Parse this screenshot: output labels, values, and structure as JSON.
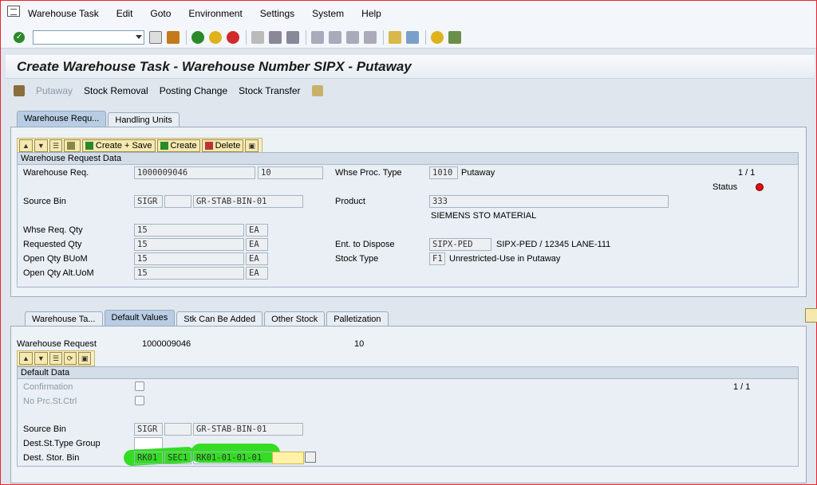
{
  "menu": [
    "Warehouse Task",
    "Edit",
    "Goto",
    "Environment",
    "Settings",
    "System",
    "Help"
  ],
  "title": "Create Warehouse Task - Warehouse Number SIPX - Putaway",
  "app_toolbar": {
    "putaway": "Putaway",
    "stock_removal": "Stock Removal",
    "posting_change": "Posting Change",
    "stock_transfer": "Stock Transfer"
  },
  "top_tabs": [
    "Warehouse Requ...",
    "Handling Units"
  ],
  "top_subtoolbar": {
    "create_save": "Create + Save",
    "create": "Create",
    "delete": "Delete"
  },
  "wr_group": {
    "title": "Warehouse Request Data",
    "warehouse_req_label": "Warehouse Req.",
    "warehouse_req_value": "1000009046",
    "warehouse_req_item": "10",
    "whse_proc_type_label": "Whse Proc. Type",
    "whse_proc_type_value": "1010",
    "whse_proc_type_text": "Putaway",
    "counter": "1 / 1",
    "status_label": "Status",
    "source_bin_label": "Source Bin",
    "source_bin_type": "SIGR",
    "source_bin_section": "",
    "source_bin_value": "GR-STAB-BIN-01",
    "product_label": "Product",
    "product_value": "333",
    "product_desc": "SIEMENS STO MATERIAL",
    "whse_req_qty_label": "Whse Req. Qty",
    "whse_req_qty": "15",
    "whse_req_qty_uom": "EA",
    "requested_qty_label": "Requested Qty",
    "requested_qty": "15",
    "requested_qty_uom": "EA",
    "open_qty_buom_label": "Open Qty BUoM",
    "open_qty_buom": "15",
    "open_qty_buom_uom": "EA",
    "open_qty_altuom_label": "Open Qty Alt.UoM",
    "open_qty_altuom": "15",
    "open_qty_altuom_uom": "EA",
    "ent_to_dispose_label": "Ent. to Dispose",
    "ent_to_dispose_value": "SIPX-PED",
    "ent_to_dispose_text": "SIPX-PED / 12345 LANE-111",
    "stock_type_label": "Stock Type",
    "stock_type_value": "F1",
    "stock_type_text": "Unrestricted-Use in Putaway"
  },
  "bottom_tabs": [
    "Warehouse Ta...",
    "Default Values",
    "Stk Can Be Added",
    "Other Stock",
    "Palletization"
  ],
  "bottom": {
    "warehouse_request_label": "Warehouse Request",
    "warehouse_request_value": "1000009046",
    "warehouse_request_item": "10",
    "default_data_title": "Default Data",
    "confirmation_label": "Confirmation",
    "no_prc_label": "No Prc.St.Ctrl",
    "counter": "1 / 1",
    "source_bin_label": "Source Bin",
    "source_bin_type": "SIGR",
    "source_bin_section": "",
    "source_bin_value": "GR-STAB-BIN-01",
    "dest_st_type_group_label": "Dest.St.Type Group",
    "dest_st_type_group_value": "",
    "dest_stor_bin_label": "Dest. Stor. Bin",
    "dest_type": "RK01",
    "dest_section": "SEC1",
    "dest_bin": "RK01-01-01-01"
  }
}
